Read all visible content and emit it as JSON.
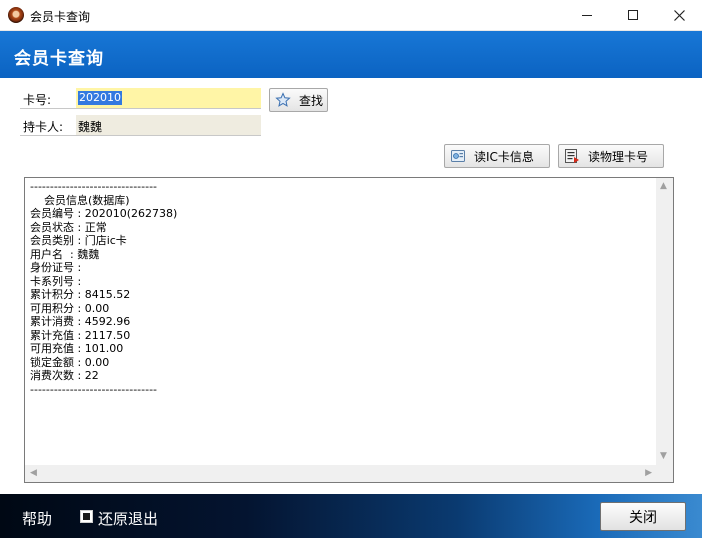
{
  "window": {
    "title": "会员卡查询"
  },
  "header": {
    "title": "会员卡查询"
  },
  "form": {
    "card_label": "卡号:",
    "card_value": "202010",
    "holder_label": "持卡人:",
    "holder_value": "魏魏"
  },
  "buttons": {
    "search": "查找",
    "read_ic": "读IC卡信息",
    "read_physical": "读物理卡号",
    "close": "关闭"
  },
  "info_text": "--------------------------------\n    会员信息(数据库)\n会员编号 : 202010(262738)\n会员状态 : 正常\n会员类别 : 门店ic卡\n用户名  : 魏魏\n身份证号 :\n卡系列号 :\n累计积分 : 8415.52\n可用积分 : 0.00\n累计消费 : 4592.96\n累计充值 : 2117.50\n可用充值 : 101.00\n锁定金额 : 0.00\n消费次数 : 22\n--------------------------------",
  "footer": {
    "help": "帮助",
    "restore_exit": "还原退出",
    "restore_checked": true
  },
  "colors": {
    "header_blue": "#0f6fcf",
    "card_field_bg": "#fff5a6",
    "holder_field_bg": "#efece0"
  },
  "icons": {
    "app": "app-logo-icon",
    "search": "search-star-icon",
    "read_ic": "card-reader-icon",
    "read_physical": "id-card-icon"
  }
}
